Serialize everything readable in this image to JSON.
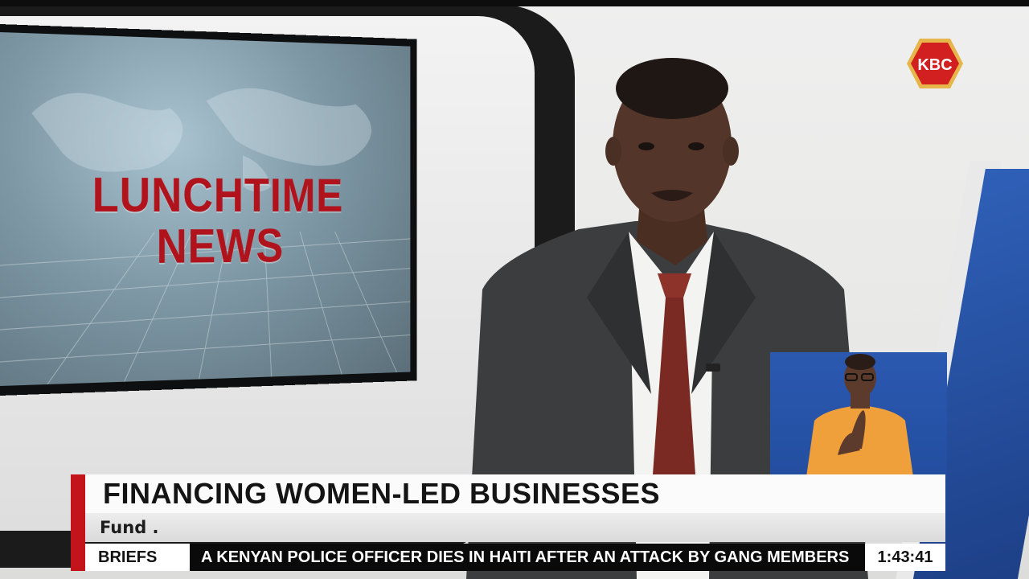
{
  "channel": {
    "logo_text": "KBC"
  },
  "studio_screen": {
    "title_line1": "LUNCHTIME",
    "title_line2": "NEWS"
  },
  "lower_third": {
    "headline": "FINANCING WOMEN-LED BUSINESSES",
    "subtitle": "Fund ."
  },
  "ticker": {
    "label": "BRIEFS",
    "text": "A KENYAN POLICE OFFICER DIES IN HAITI AFTER AN ATTACK BY GANG MEMBERS",
    "clock": "1:43:41"
  },
  "colors": {
    "brand_red": "#c4141b",
    "logo_red": "#d21f1f",
    "logo_gold": "#e7b64a",
    "screen_title_red": "#b0131c",
    "inset_blue": "#2b59b0",
    "ticker_bg": "#0a0a0a"
  }
}
